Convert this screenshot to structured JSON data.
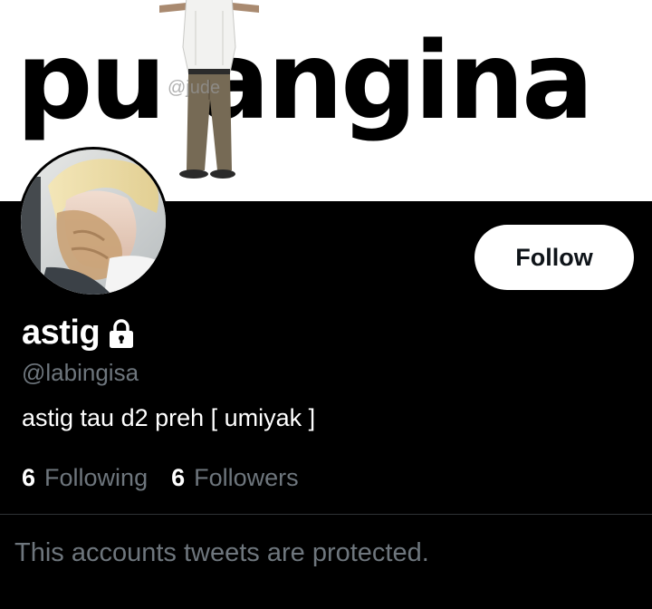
{
  "banner": {
    "text": "pu angina",
    "watermark": "@jude"
  },
  "profile": {
    "display_name": "astig",
    "lock_icon": "lock-icon",
    "handle": "@labingisa",
    "bio": "astig tau d2 preh [ umiyak ]",
    "following_count": "6",
    "following_label": "Following",
    "followers_count": "6",
    "followers_label": "Followers"
  },
  "actions": {
    "follow_label": "Follow"
  },
  "notice": {
    "protected_text": "This accounts tweets are protected."
  },
  "colors": {
    "background": "#000000",
    "secondary_text": "#6e767d",
    "divider": "#2f3336",
    "button_bg": "#ffffff"
  }
}
